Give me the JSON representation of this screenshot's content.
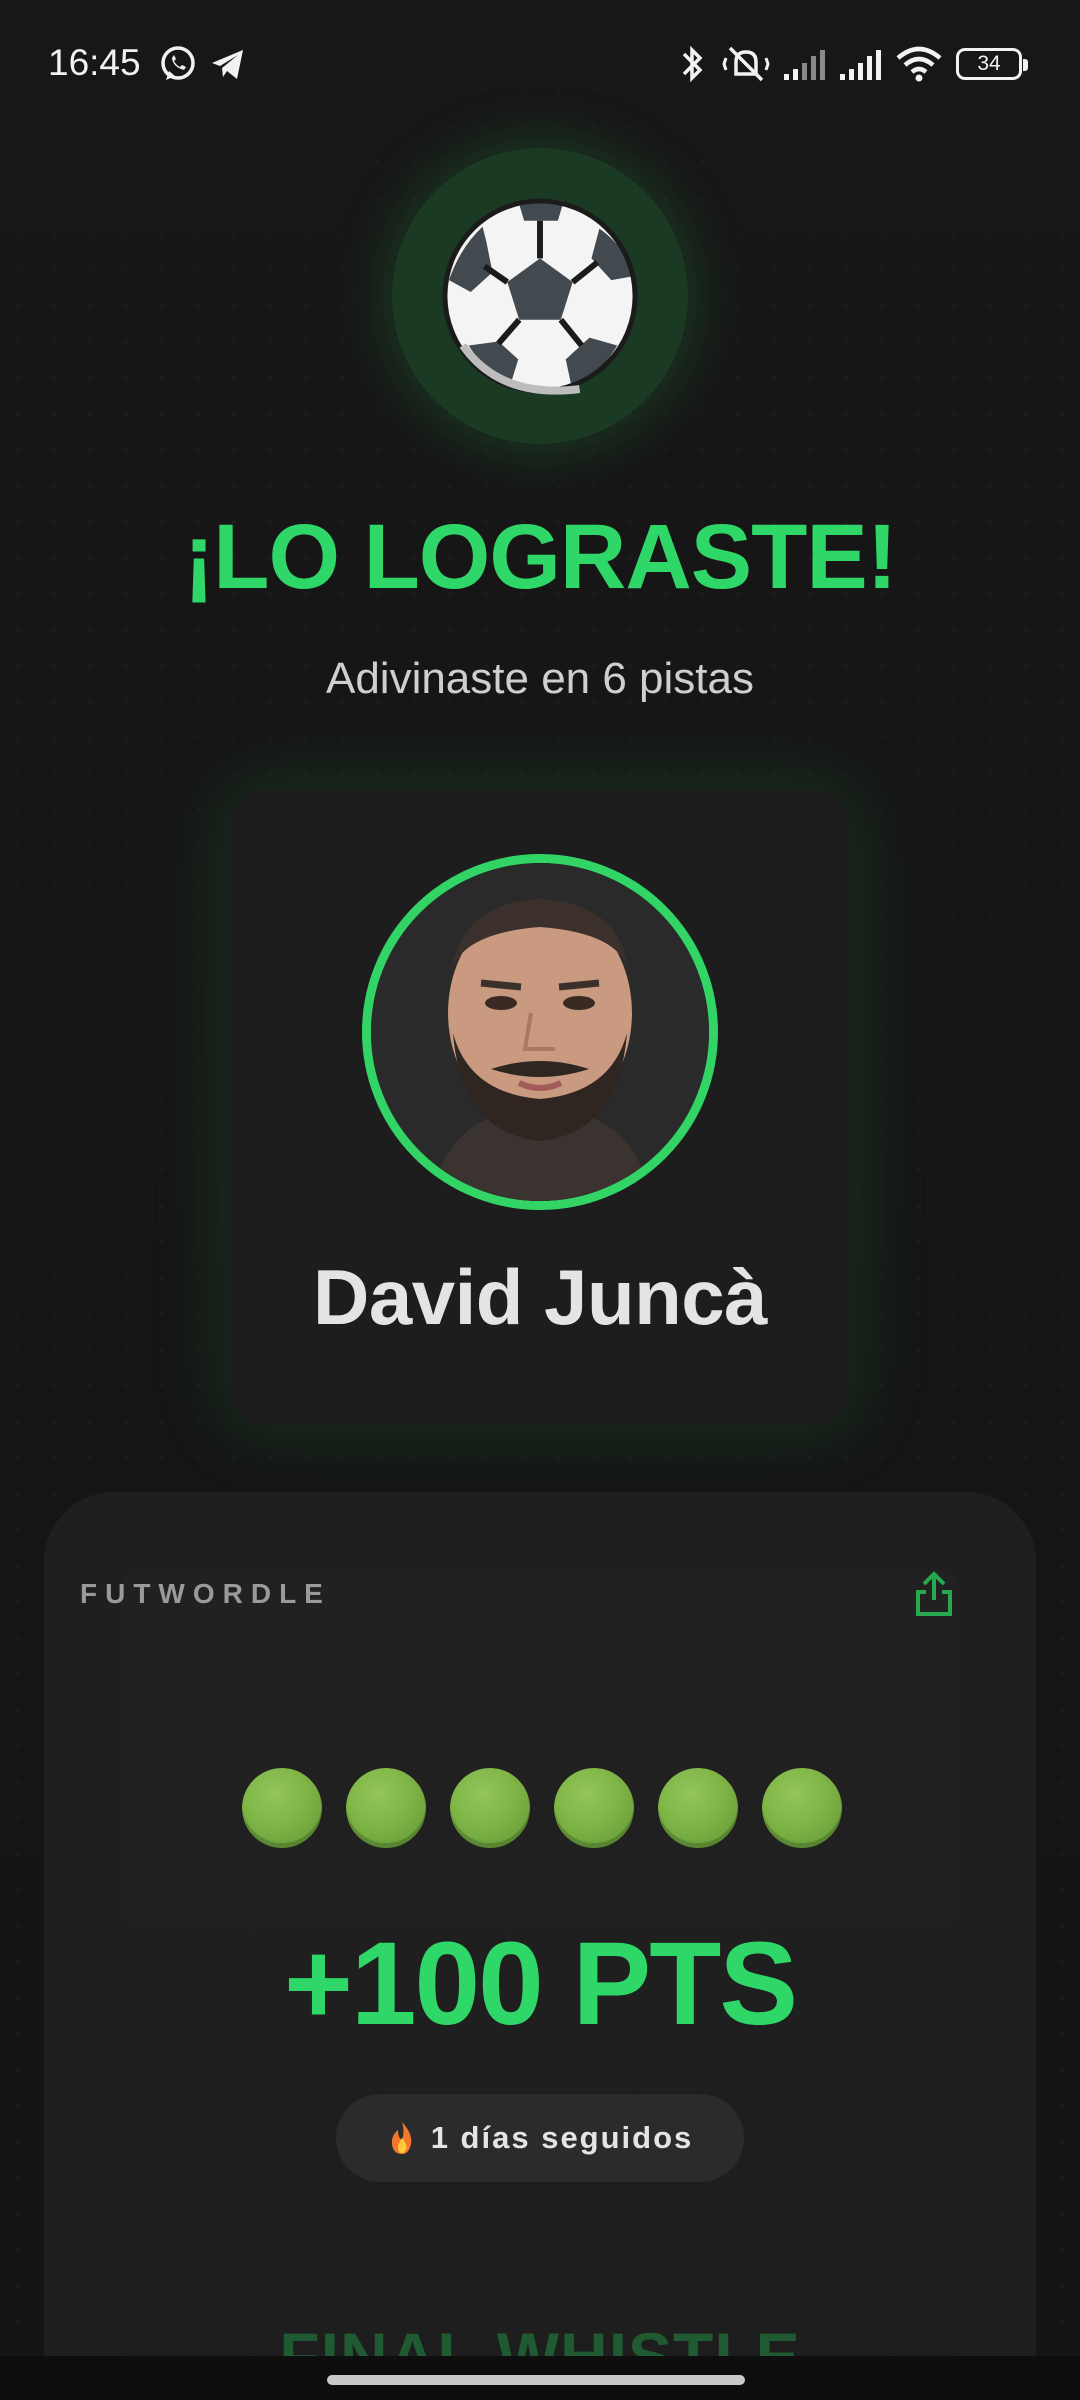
{
  "status_bar": {
    "time": "16:45",
    "battery": "34",
    "icons": [
      "whatsapp-icon",
      "telegram-icon",
      "bluetooth-icon",
      "silent-vibrate-icon",
      "signal-icon",
      "signal-icon",
      "wifi-icon",
      "battery-icon"
    ]
  },
  "hero": {
    "icon": "soccer-ball-icon",
    "title": "¡LO LOGRASTE!",
    "subtitle": "Adivinaste en 6 pistas"
  },
  "player": {
    "name": "David Juncà",
    "avatar": "player-photo"
  },
  "result": {
    "brand": "FUTWORDLE",
    "share_icon": "share-icon",
    "clue_dots": [
      "🟢",
      "🟢",
      "🟢",
      "🟢",
      "🟢",
      "🟢"
    ],
    "points": "+100 PTS",
    "streak_icon": "🔥",
    "streak": "1 días seguidos",
    "next_title": "FINAL WHISTLE"
  },
  "colors": {
    "accent_green": "#2fd768",
    "dot_green": "#7fb547",
    "background": "#151515",
    "card": "#1d1d1d"
  }
}
